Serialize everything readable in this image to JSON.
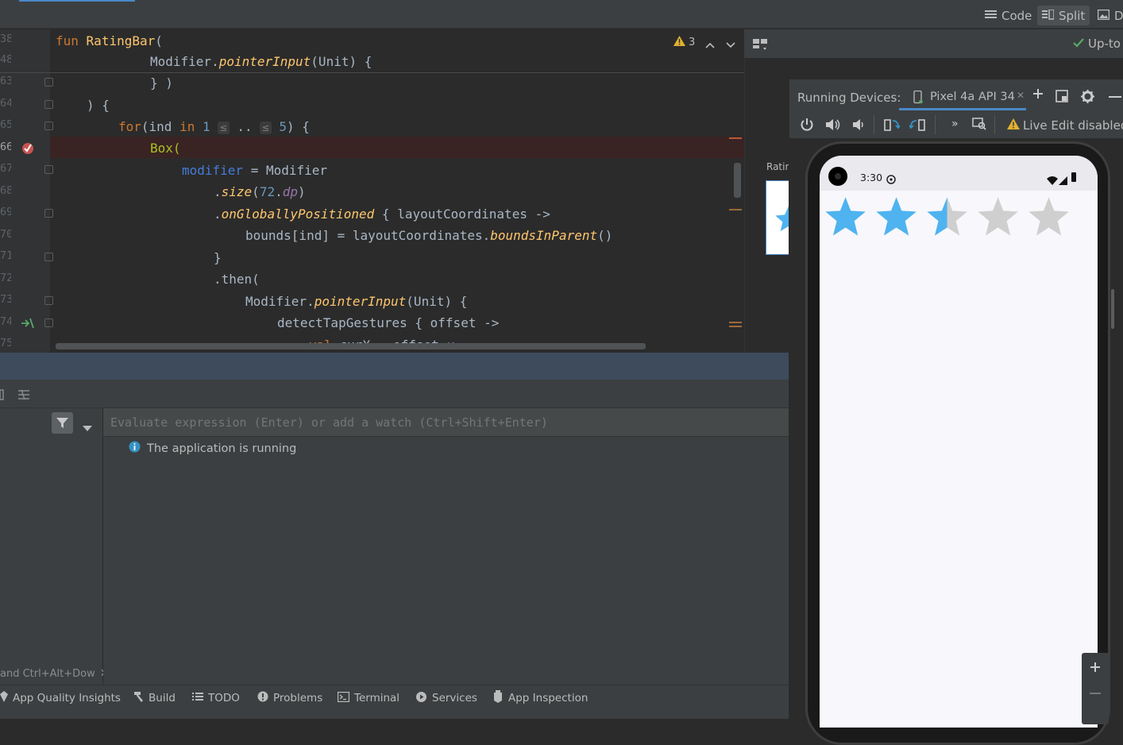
{
  "topbar": {
    "views": [
      {
        "label": "Code",
        "icon": "lines-icon",
        "active": false
      },
      {
        "label": "Split",
        "icon": "split-icon",
        "active": true
      },
      {
        "label": "De",
        "icon": "image-icon",
        "active": false
      }
    ]
  },
  "editor": {
    "warnings_count": "3",
    "lines": [
      {
        "no": "38",
        "text": "fun RatingBar("
      },
      {
        "no": "48",
        "text": "Modifier.pointerInput(Unit) {"
      },
      {
        "no": "63",
        "text": "} )"
      },
      {
        "no": "64",
        "text": ") {"
      },
      {
        "no": "65",
        "text": "for(ind in 1 ≤ .. ≤ 5) {"
      },
      {
        "no": "66",
        "text": "Box("
      },
      {
        "no": "67",
        "text": "modifier = Modifier"
      },
      {
        "no": "68",
        "text": ".size(72.dp)"
      },
      {
        "no": "69",
        "text": ".onGloballyPositioned { layoutCoordinates ->"
      },
      {
        "no": "70",
        "text": "bounds[ind] = layoutCoordinates.boundsInParent()"
      },
      {
        "no": "71",
        "text": "}"
      },
      {
        "no": "72",
        "text": ".then("
      },
      {
        "no": "73",
        "text": "Modifier.pointerInput(Unit) {"
      },
      {
        "no": "74",
        "text": "detectTapGestures { offset ->"
      },
      {
        "no": "75",
        "text": "val curX = offset.x"
      }
    ],
    "tokens": {
      "fun": "fun",
      "ratingbar": "RatingBar",
      "lparen": "(",
      "modifier": "Modifier",
      "dot": ".",
      "pointerInput": "pointerInput",
      "unit": "(Unit) {",
      "close1": "} )",
      "close2": ") {",
      "for": "for",
      "ind": "(ind ",
      "in": "in",
      "one": "1",
      "le1": "≤",
      "dotdot": "..",
      "le2": "≤",
      "five": "5",
      "tail5": ") {",
      "box": "Box(",
      "modifierNamed": "modifier",
      "eq": " = Modifier",
      "sizeDot": ".",
      "size": "size",
      "seventytwo": "72",
      "dpdot": ".",
      "dp": "dp",
      "rp": ")",
      "ogpDot": ".",
      "ogp": "onGloballyPositioned",
      "ogpTail": " { layoutCoordinates ->",
      "boundsA": "bounds[ind] = layoutCoordinates.",
      "bip": "boundsInParent",
      "bipTail": "()",
      "brace": "}",
      "then": ".then(",
      "mod2": "Modifier.",
      "pi2": "pointerInput",
      "unit2": "(Unit) {",
      "dtg": "detectTapGestures { offset ->",
      "val": "val",
      "curx": " curX = offset.",
      "x": "x"
    }
  },
  "preview": {
    "label": "Ratin"
  },
  "debugger": {
    "eval_placeholder": "Evaluate expression (Enter) or add a watch (Ctrl+Shift+Enter)",
    "status_message": "The application is running",
    "hint_text": "and Ctrl+Alt+Dow"
  },
  "devices": {
    "title": "Running Devices:",
    "device_tab": "Pixel 4a API 34",
    "live_edit": "Live Edit disabled",
    "up_to_date": "Up-to",
    "phone": {
      "time": "3:30",
      "rating_value": 2.5,
      "rating_max": 5,
      "star_filled_color": "#4fb3ef",
      "star_empty_color": "#cfcfcf"
    }
  },
  "toolwindows": [
    {
      "label": "App Quality Insights",
      "icon": "diamond-icon"
    },
    {
      "label": "Build",
      "icon": "hammer-icon"
    },
    {
      "label": "TODO",
      "icon": "list-icon"
    },
    {
      "label": "Problems",
      "icon": "info-circle-icon"
    },
    {
      "label": "Terminal",
      "icon": "terminal-icon"
    },
    {
      "label": "Services",
      "icon": "services-icon"
    },
    {
      "label": "App Inspection",
      "icon": "inspection-icon"
    }
  ],
  "colors": {
    "accent": "#4a88c7",
    "breakpoint": "#c75450",
    "warning": "#e0b030",
    "info": "#3592c4"
  }
}
